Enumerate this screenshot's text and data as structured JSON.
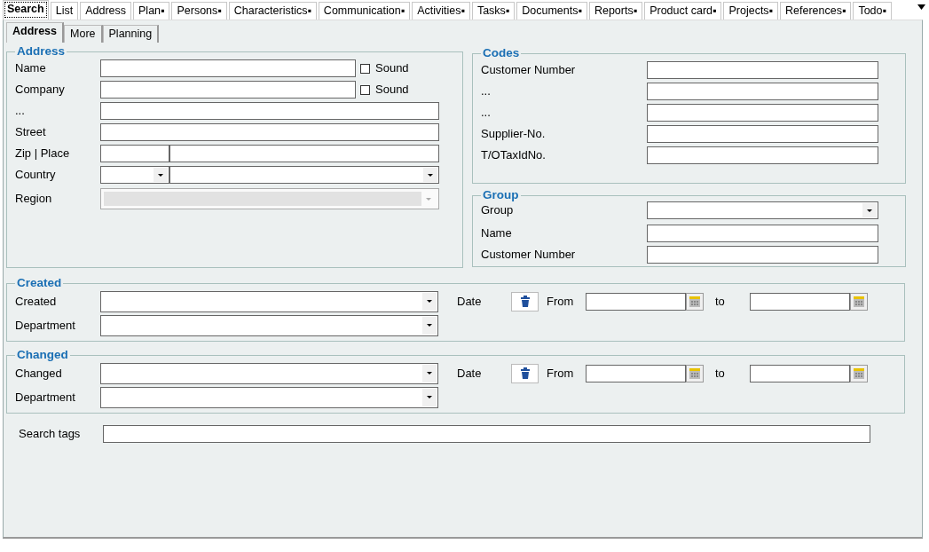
{
  "main_tabs": [
    {
      "label": "Search",
      "selected": true
    },
    {
      "label": "List",
      "selected": false
    },
    {
      "label": "Address",
      "selected": false
    },
    {
      "label": "Plan▪",
      "selected": false
    },
    {
      "label": "Persons▪",
      "selected": false
    },
    {
      "label": "Characteristics▪",
      "selected": false
    },
    {
      "label": "Communication▪",
      "selected": false
    },
    {
      "label": "Activities▪",
      "selected": false
    },
    {
      "label": "Tasks▪",
      "selected": false
    },
    {
      "label": "Documents▪",
      "selected": false
    },
    {
      "label": "Reports▪",
      "selected": false
    },
    {
      "label": "Product card▪",
      "selected": false
    },
    {
      "label": "Projects▪",
      "selected": false
    },
    {
      "label": "References▪",
      "selected": false
    },
    {
      "label": "Todo▪",
      "selected": false
    }
  ],
  "sub_tabs": [
    {
      "label": "Address",
      "selected": true
    },
    {
      "label": "More",
      "selected": false
    },
    {
      "label": "Planning",
      "selected": false
    }
  ],
  "address": {
    "title": "Address",
    "rows": [
      {
        "label": "Name",
        "kind": "text_check",
        "check": {
          "label": "Sound",
          "checked": false
        }
      },
      {
        "label": "Company",
        "kind": "text_check",
        "check": {
          "label": "Sound",
          "checked": false
        }
      },
      {
        "label": "...",
        "kind": "text"
      },
      {
        "label": "Street",
        "kind": "text"
      },
      {
        "label": "Zip | Place",
        "kind": "split"
      },
      {
        "label": "Country",
        "kind": "split_combo"
      },
      {
        "label": "Region",
        "kind": "combo",
        "disabled": true
      }
    ]
  },
  "codes": {
    "title": "Codes",
    "rows": [
      {
        "label": "Customer Number",
        "kind": "text"
      },
      {
        "label": "...",
        "kind": "text"
      },
      {
        "label": "...",
        "kind": "text"
      },
      {
        "label": "Supplier-No.",
        "kind": "text"
      },
      {
        "label": "T/OTaxIdNo.",
        "kind": "text"
      }
    ]
  },
  "group": {
    "title": "Group",
    "rows": [
      {
        "label": "Group",
        "kind": "combo",
        "disabled": false
      },
      {
        "label": "Name",
        "kind": "text"
      },
      {
        "label": "Customer Number",
        "kind": "text"
      }
    ]
  },
  "date_sections": [
    {
      "title": "Created",
      "rows": [
        {
          "label": "Created"
        },
        {
          "label": "Department"
        }
      ],
      "date": {
        "label": "Date",
        "from_label": "From",
        "to_label": "to"
      }
    },
    {
      "title": "Changed",
      "rows": [
        {
          "label": "Changed"
        },
        {
          "label": "Department"
        }
      ],
      "date": {
        "label": "Date",
        "from_label": "From",
        "to_label": "to"
      }
    }
  ],
  "search_tags": {
    "label": "Search tags"
  }
}
